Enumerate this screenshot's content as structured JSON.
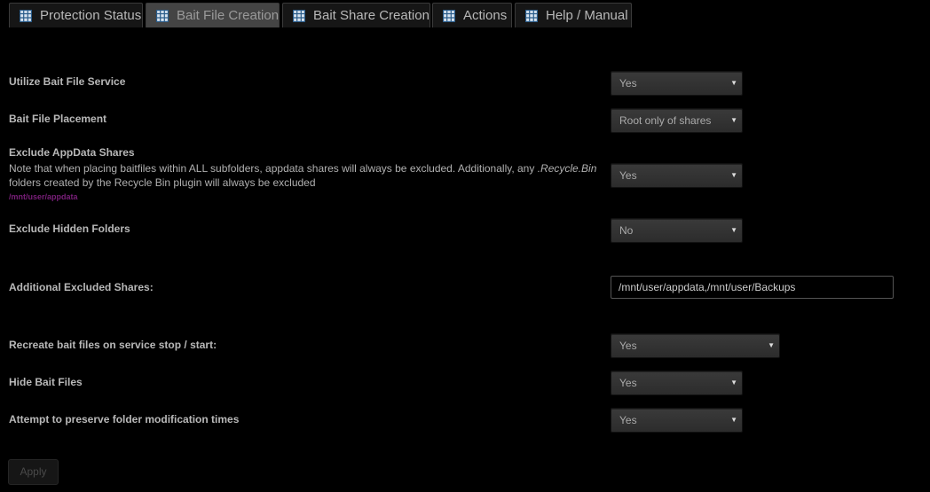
{
  "tabs": [
    {
      "label": "Protection Status",
      "icon": "grid-icon",
      "active": false
    },
    {
      "label": "Bait File Creation",
      "icon": "grid-icon",
      "active": true
    },
    {
      "label": "Bait Share Creation",
      "icon": "grid-icon",
      "active": false
    },
    {
      "label": "Actions",
      "icon": "grid-icon",
      "active": false
    },
    {
      "label": "Help / Manual",
      "icon": "grid-icon",
      "active": false
    }
  ],
  "settings": {
    "utilize": {
      "label": "Utilize Bait File Service",
      "value": "Yes"
    },
    "placement": {
      "label": "Bait File Placement",
      "value": "Root only of shares"
    },
    "exclude_appdata": {
      "label": "Exclude AppData Shares",
      "note_line1_a": "Note that when placing baitfiles within ALL subfolders, appdata shares will always be excluded. Additionally, any ",
      "note_line1_em": ".Recycle.Bin",
      "note_line2": "folders created by the Recycle Bin plugin will always be excluded",
      "path": "/mnt/user/appdata",
      "value": "Yes"
    },
    "exclude_hidden": {
      "label": "Exclude Hidden Folders",
      "value": "No"
    },
    "additional_excluded": {
      "label": "Additional Excluded Shares:",
      "value": "/mnt/user/appdata,/mnt/user/Backups"
    },
    "recreate": {
      "label": "Recreate bait files on service stop / start:",
      "value": "Yes"
    },
    "hide": {
      "label": "Hide Bait Files",
      "value": "Yes"
    },
    "preserve_times": {
      "label": "Attempt to preserve folder modification times",
      "value": "Yes"
    }
  },
  "apply_label": "Apply",
  "colors": {
    "background": "#000000",
    "tab_active": "#444444",
    "path_text": "#7a1f7a"
  }
}
